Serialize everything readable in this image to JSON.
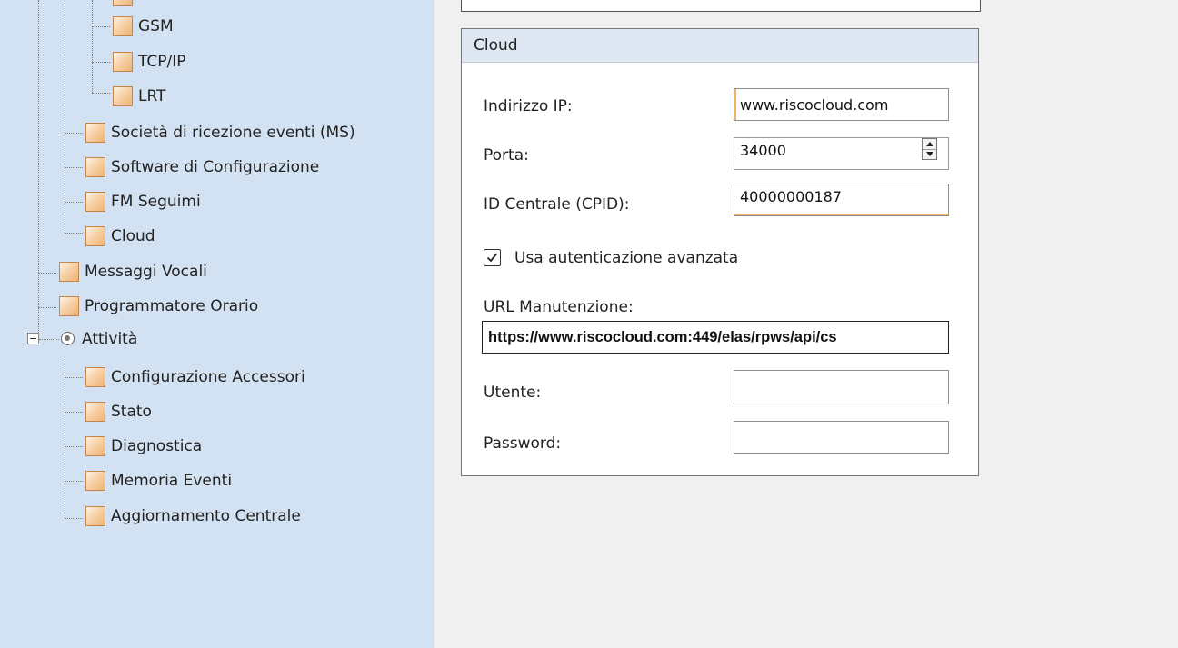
{
  "sidebar": {
    "tree": {
      "gsm": "GSM",
      "tcpip": "TCP/IP",
      "lrt": "LRT",
      "ms": "Società di ricezione eventi (MS)",
      "software_config": "Software di Configurazione",
      "fm_seguimi": "FM Seguimi",
      "cloud": "Cloud",
      "messaggi_vocali": "Messaggi Vocali",
      "programmatore_orario": "Programmatore Orario",
      "attivita": "Attività",
      "configurazione_accessori": "Configurazione Accessori",
      "stato": "Stato",
      "diagnostica": "Diagnostica",
      "memoria_eventi": "Memoria Eventi",
      "aggiornamento_centrale": "Aggiornamento Centrale"
    },
    "node_icon": "folder-square-icon",
    "attivita_icon": "radio-circle-icon",
    "expander_icon": "collapse-minus-icon"
  },
  "cloud_panel": {
    "title": "Cloud",
    "ip_label": "Indirizzo IP:",
    "ip_value": "www.riscocloud.com",
    "port_label": "Porta:",
    "port_value": "34000",
    "cpid_label": "ID Centrale (CPID):",
    "cpid_value": "40000000187",
    "advanced_auth_label": "Usa autenticazione avanzata",
    "advanced_auth_checked": true,
    "url_label": "URL Manutenzione:",
    "url_value": "https://www.riscocloud.com:449/elas/rpws/api/cs",
    "user_label": "Utente:",
    "user_value": "",
    "password_label": "Password:",
    "password_value": ""
  },
  "colors": {
    "sidebar_bg": "#d3e2f2",
    "panel_header_bg": "#dfe8f2",
    "node_icon_orange": "#f0b26e",
    "input_accent": "#f0b065",
    "content_bg": "#f0f0f0"
  }
}
